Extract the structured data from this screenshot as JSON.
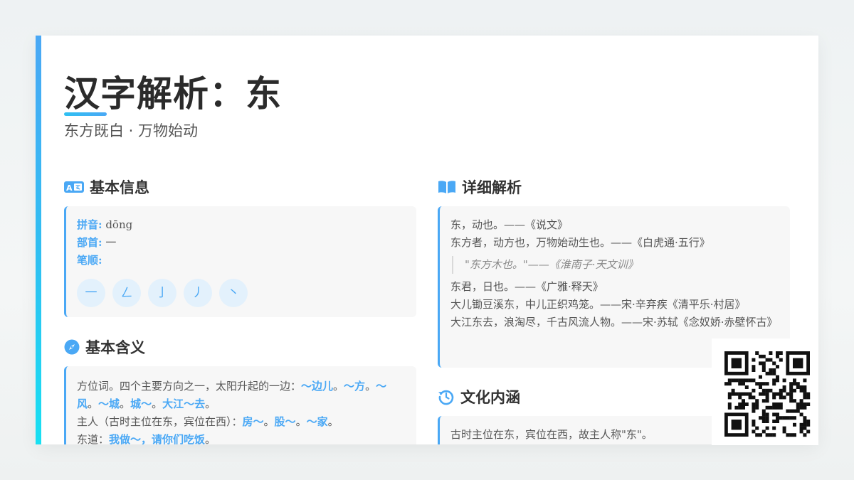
{
  "header": {
    "title": "汉字解析：东",
    "subtitle": "东方既白 · 万物始动"
  },
  "basic_info": {
    "heading": "基本信息",
    "pinyin_label": "拼音:",
    "pinyin": "dōng",
    "radical_label": "部首:",
    "radical": "一",
    "stroke_label": "笔顺:",
    "strokes": [
      "一",
      "ㄥ",
      "亅",
      "丿",
      "丶"
    ]
  },
  "meaning": {
    "heading": "基本含义",
    "lines": [
      {
        "parts": [
          {
            "t": "方位词。四个主要方向之一，太阳升起的一边：",
            "h": false
          },
          {
            "t": "～边儿",
            "h": true
          },
          {
            "t": "。",
            "h": false
          },
          {
            "t": "～方",
            "h": true
          },
          {
            "t": "。",
            "h": false
          },
          {
            "t": "～风",
            "h": true
          },
          {
            "t": "。",
            "h": false
          },
          {
            "t": "～城",
            "h": true
          },
          {
            "t": "。",
            "h": false
          },
          {
            "t": "城～",
            "h": true
          },
          {
            "t": "。",
            "h": false
          },
          {
            "t": "大江～去",
            "h": true
          },
          {
            "t": "。",
            "h": false
          }
        ]
      },
      {
        "parts": [
          {
            "t": "主人（古时主位在东，宾位在西）：",
            "h": false
          },
          {
            "t": "房～",
            "h": true
          },
          {
            "t": "。",
            "h": false
          },
          {
            "t": "股～",
            "h": true
          },
          {
            "t": "。",
            "h": false
          },
          {
            "t": "～家",
            "h": true
          },
          {
            "t": "。",
            "h": false
          }
        ]
      },
      {
        "parts": [
          {
            "t": "东道：",
            "h": false
          },
          {
            "t": "我做～，请你们吃饭",
            "h": true
          },
          {
            "t": "。",
            "h": false
          }
        ]
      }
    ]
  },
  "detail": {
    "heading": "详细解析",
    "line1": "东，动也。——《说文》",
    "line2": "东方者，动方也，万物始动生也。——《白虎通·五行》",
    "quote": "\"东方木也。\"——《淮南子·天文训》",
    "line3": "东君，日也。——《广雅·释天》",
    "line4": "大儿锄豆溪东，中儿正织鸡笼。——宋·辛弃疾《清平乐·村居》",
    "line5": "大江东去，浪淘尽，千古风流人物。——宋·苏轼《念奴娇·赤壁怀古》"
  },
  "culture": {
    "heading": "文化内涵",
    "line1": "古时主位在东，宾位在西，故主人称\"东\"。"
  },
  "colors": {
    "accent": "#4aa8f5",
    "accent_cyan": "#18e0f2",
    "panel_bg": "#f7f7f7"
  },
  "icons": {
    "basic_info": "translate-icon",
    "meaning": "compass-icon",
    "detail": "book-icon",
    "culture": "history-icon",
    "qr": "qr-code-icon"
  }
}
